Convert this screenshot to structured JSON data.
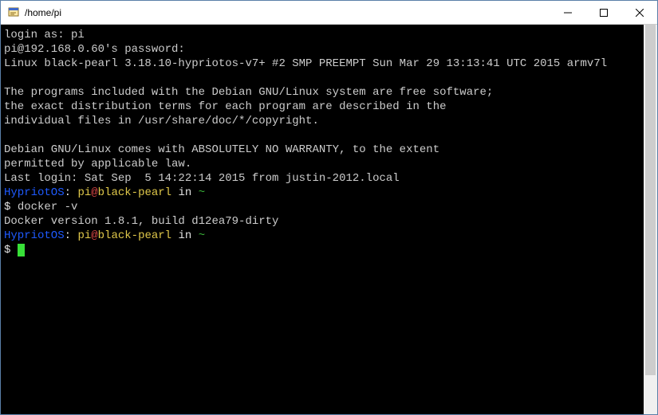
{
  "window": {
    "title": "/home/pi"
  },
  "terminal": {
    "login_prompt": "login as: ",
    "login_user": "pi",
    "password_prompt": "pi@192.168.0.60's password:",
    "motd_line1": "Linux black-pearl 3.18.10-hypriotos-v7+ #2 SMP PREEMPT Sun Mar 29 13:13:41 UTC 2015 armv7l",
    "motd_line2": "",
    "motd_line3": "The programs included with the Debian GNU/Linux system are free software;",
    "motd_line4": "the exact distribution terms for each program are described in the",
    "motd_line5": "individual files in /usr/share/doc/*/copyright.",
    "motd_line6": "",
    "motd_line7": "Debian GNU/Linux comes with ABSOLUTELY NO WARRANTY, to the extent",
    "motd_line8": "permitted by applicable law.",
    "last_login": "Last login: Sat Sep  5 14:22:14 2015 from justin-2012.local",
    "ps1": {
      "os": "HypriotOS",
      "sep1": ": ",
      "user": "pi",
      "at": "@",
      "host": "black-pearl",
      "in": " in ",
      "path": "~"
    },
    "prompt_symbol": "$ ",
    "cmd1": "docker -v",
    "cmd1_output": "Docker version 1.8.1, build d12ea79-dirty"
  }
}
